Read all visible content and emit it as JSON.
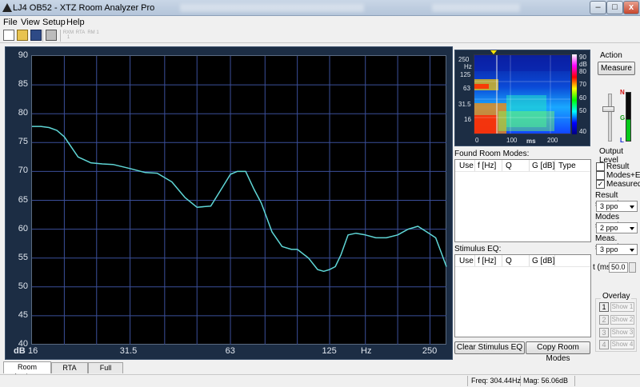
{
  "window": {
    "title": "LJ4 OB52 - XTZ Room Analyzer Pro",
    "min_label": "–",
    "max_label": "□",
    "close_label": "x"
  },
  "menu": {
    "file": "File",
    "view": "View",
    "setup": "Setup",
    "help": "Help"
  },
  "toolbar": {
    "rxm": "RXM 1",
    "rta": "RTA",
    "rtm": "RM 1"
  },
  "chart_data": {
    "type": "line",
    "xscale": "log",
    "xlim": [
      16,
      280
    ],
    "ylim": [
      40,
      90
    ],
    "ylabel": "dB",
    "xlabel": "Hz",
    "y_ticks": [
      "90",
      "85",
      "80",
      "75",
      "70",
      "65",
      "60",
      "55",
      "50",
      "45",
      "40"
    ],
    "x_ticks": [
      {
        "value": 16,
        "label": "16"
      },
      {
        "value": 31.5,
        "label": "31.5"
      },
      {
        "value": 63,
        "label": "63"
      },
      {
        "value": 125,
        "label": "125"
      },
      {
        "value": 250,
        "label": "250"
      }
    ],
    "gridlines_x": [
      16,
      20,
      25,
      31.5,
      40,
      50,
      63,
      80,
      100,
      125,
      160,
      200,
      250
    ],
    "grid": true,
    "line_color": "#5fd6d6",
    "series": [
      {
        "x": [
          16,
          17,
          18,
          19,
          20,
          22,
          24,
          26,
          28,
          31.5,
          35,
          38,
          42,
          46,
          50,
          55,
          60,
          63,
          66,
          70,
          74,
          78,
          84,
          90,
          96,
          100,
          108,
          115,
          120,
          125,
          130,
          135,
          142,
          150,
          160,
          172,
          185,
          200,
          215,
          230,
          245,
          260,
          270,
          280
        ],
        "y": [
          77.8,
          77.8,
          77.6,
          77.1,
          76,
          72.5,
          71.5,
          71.3,
          71.2,
          70.5,
          69.8,
          69.7,
          68.2,
          65.5,
          63.8,
          64,
          67.5,
          69.5,
          70,
          70,
          67,
          64.5,
          59.5,
          57,
          56.5,
          56.5,
          55,
          53,
          52.7,
          53,
          53.5,
          55.5,
          59,
          59.3,
          59,
          58.5,
          58.5,
          59,
          60,
          60.5,
          59.5,
          58.5,
          56,
          53.5
        ]
      }
    ]
  },
  "spectrogram": {
    "y_labels": [
      "250",
      "Hz",
      "125",
      "63",
      "31.5",
      "16"
    ],
    "x_labels": [
      "0",
      "100",
      "ms",
      "200"
    ],
    "scale_labels": [
      "90",
      "dB",
      "80",
      "70",
      "60",
      "50",
      "40"
    ]
  },
  "found_modes": {
    "title": "Found Room Modes:",
    "columns": [
      "Use",
      "f [Hz]",
      "Q",
      "G [dB]",
      "Type"
    ]
  },
  "stimulus_eq": {
    "title": "Stimulus EQ:",
    "columns": [
      "Use",
      "f [Hz]",
      "Q",
      "G [dB]"
    ]
  },
  "buttons": {
    "clear_eq": "Clear Stimulus EQ",
    "copy_modes": "Copy Room Modes",
    "measure": "Measure"
  },
  "action": {
    "title": "Action",
    "output_level": "Output Level",
    "meter": {
      "n": "N",
      "g": "G",
      "l": "L"
    }
  },
  "options": {
    "result": {
      "label": "Result",
      "checked": false
    },
    "modes_eq": {
      "label": "Modes+EQ",
      "checked": false
    },
    "measured": {
      "label": "Measured",
      "checked": true,
      "mark": "✓"
    },
    "result_smooth": {
      "label": "Result smooth:",
      "value": "3 ppo"
    },
    "modes_smooth": {
      "label": "Modes smooth:",
      "value": "2 ppo"
    },
    "meas_smooth": {
      "label": "Meas. smooth:",
      "value": "3 ppo"
    },
    "t_ms": {
      "label": "t (ms)",
      "value": "50.0"
    }
  },
  "overlay": {
    "title": "Overlay",
    "items": [
      {
        "num": "1",
        "label": "Show 1"
      },
      {
        "num": "2",
        "label": "Show 2"
      },
      {
        "num": "3",
        "label": "Show 3"
      },
      {
        "num": "4",
        "label": "Show 4"
      }
    ]
  },
  "tabs": [
    "Room Analyzer",
    "RTA",
    "Full Range"
  ],
  "status": {
    "freq": "Freq: 304.44Hz",
    "mag": "Mag: 56.06dB"
  }
}
